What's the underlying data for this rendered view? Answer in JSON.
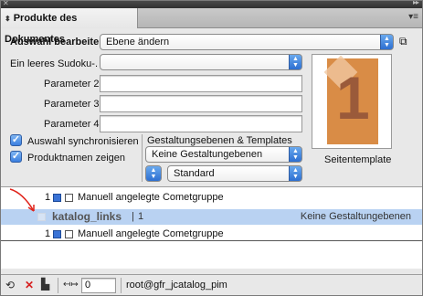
{
  "panel": {
    "tab_title": "Produkte des Dokumentes",
    "tab_arrows": "⬍"
  },
  "selection": {
    "label": "Auswahl bearbeiten",
    "value": "Ebene ändern"
  },
  "template": {
    "value": "Ein leeres Sudoku-..."
  },
  "parameters": [
    {
      "label": "Parameter 2"
    },
    {
      "label": "Parameter 3"
    },
    {
      "label": "Parameter 4"
    }
  ],
  "checkboxes": [
    {
      "label": "Auswahl synchronisieren",
      "checked": true
    },
    {
      "label": "Produktnamen zeigen",
      "checked": true
    }
  ],
  "layers": {
    "heading": "Gestaltungsebenen & Templates",
    "layer_value": "Keine Gestaltungebenen",
    "template_value": "Standard"
  },
  "preview": {
    "caption": "Seitentemplate",
    "page_number": "1"
  },
  "list": {
    "rows": [
      {
        "count": "1",
        "name": "Manuell angelegte Cometgruppe"
      },
      {
        "name": "katalog_links",
        "count": "1",
        "right": "Keine Gestaltungebenen"
      },
      {
        "count": "1",
        "name": "Manuell angelegte Cometgruppe"
      }
    ]
  },
  "footer": {
    "counter_value": "0",
    "connection": "root@gfr_jcatalog_pim"
  },
  "colors": {
    "selected_row": "#b9d2f2",
    "accent_blue": "#3a7fe0",
    "arrow_red": "#e0241b"
  }
}
